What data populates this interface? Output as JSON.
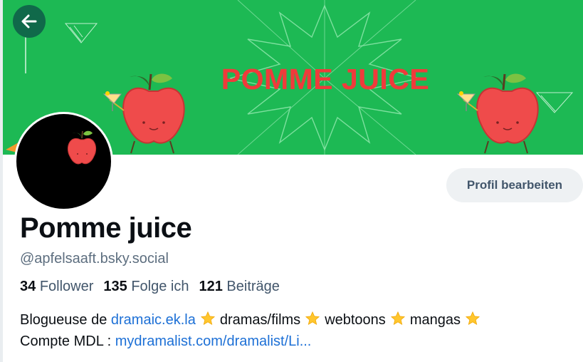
{
  "banner": {
    "title": "POMME JUICE",
    "background_color": "#1db954",
    "title_color": "#ef3b3b",
    "decorations": [
      "apple-mascot-icon",
      "cocktail-glass-icon",
      "starburst-lines"
    ]
  },
  "navigation": {
    "back_icon": "arrow-left-icon"
  },
  "avatar": {
    "icon": "apple-icon",
    "background_color": "#000000"
  },
  "actions": {
    "edit_profile_label": "Profil bearbeiten"
  },
  "profile": {
    "display_name": "Pomme juice",
    "handle": "@apfelsaaft.bsky.social"
  },
  "stats": {
    "followers_count": "34",
    "followers_label": "Follower",
    "following_count": "135",
    "following_label": "Folge ich",
    "posts_count": "121",
    "posts_label": "Beiträge"
  },
  "bio": {
    "line1_prefix": "Blogueuse de",
    "line1_link": "dramaic.ek.la",
    "line1_item1": "dramas/films",
    "line1_item2": "webtoons",
    "line1_item3": "mangas",
    "line2_prefix": "Compte MDL :",
    "line2_link": "mydramalist.com/dramalist/Li...",
    "separator_icon": "star-icon",
    "link_color": "#1d70d6"
  }
}
